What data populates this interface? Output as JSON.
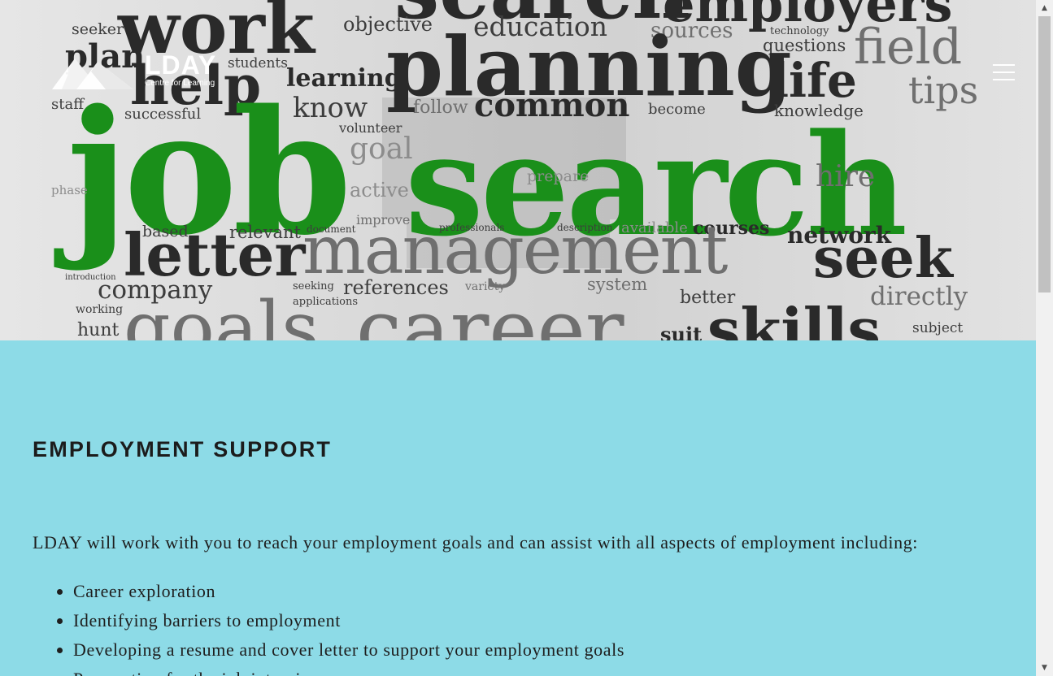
{
  "hero": {
    "words": [
      {
        "text": "employers",
        "cls": "blk"
      },
      {
        "text": "work",
        "cls": "blk"
      },
      {
        "text": "search",
        "cls": "blk"
      },
      {
        "text": "seeker",
        "cls": "drk"
      },
      {
        "text": "plan",
        "cls": "blk"
      },
      {
        "text": "objective",
        "cls": "drk"
      },
      {
        "text": "education",
        "cls": "drk"
      },
      {
        "text": "sources",
        "cls": "gry"
      },
      {
        "text": "technology",
        "cls": "drk"
      },
      {
        "text": "field",
        "cls": "gry"
      },
      {
        "text": "questions",
        "cls": "drk"
      },
      {
        "text": "planning",
        "cls": "blk"
      },
      {
        "text": "life",
        "cls": "blk"
      },
      {
        "text": "tips",
        "cls": "gry"
      },
      {
        "text": "help",
        "cls": "blk"
      },
      {
        "text": "students",
        "cls": "drk"
      },
      {
        "text": "learning",
        "cls": "blk"
      },
      {
        "text": "staff",
        "cls": "drk"
      },
      {
        "text": "successful",
        "cls": "drk"
      },
      {
        "text": "know",
        "cls": "drk"
      },
      {
        "text": "follow",
        "cls": "gry"
      },
      {
        "text": "common",
        "cls": "blk"
      },
      {
        "text": "become",
        "cls": "drk"
      },
      {
        "text": "knowledge",
        "cls": "drk"
      },
      {
        "text": "volunteer",
        "cls": "drk"
      },
      {
        "text": "job",
        "cls": "grn"
      },
      {
        "text": "search",
        "cls": "grn"
      },
      {
        "text": "goal",
        "cls": "lgt"
      },
      {
        "text": "prepare",
        "cls": "lgt"
      },
      {
        "text": "hire",
        "cls": "gry"
      },
      {
        "text": "phase",
        "cls": "lgt"
      },
      {
        "text": "active",
        "cls": "lgt"
      },
      {
        "text": "improve",
        "cls": "gry"
      },
      {
        "text": "based",
        "cls": "drk"
      },
      {
        "text": "relevant",
        "cls": "drk"
      },
      {
        "text": "document",
        "cls": "drk"
      },
      {
        "text": "professionals",
        "cls": "drk"
      },
      {
        "text": "description",
        "cls": "drk"
      },
      {
        "text": "available",
        "cls": "lgt"
      },
      {
        "text": "courses",
        "cls": "blk"
      },
      {
        "text": "network",
        "cls": "blk"
      },
      {
        "text": "letter",
        "cls": "blk"
      },
      {
        "text": "management",
        "cls": "gry"
      },
      {
        "text": "seek",
        "cls": "blk"
      },
      {
        "text": "introduction",
        "cls": "drk"
      },
      {
        "text": "company",
        "cls": "drk"
      },
      {
        "text": "seeking",
        "cls": "drk"
      },
      {
        "text": "applications",
        "cls": "drk"
      },
      {
        "text": "references",
        "cls": "drk"
      },
      {
        "text": "variety",
        "cls": "gry"
      },
      {
        "text": "system",
        "cls": "gry"
      },
      {
        "text": "better",
        "cls": "drk"
      },
      {
        "text": "directly",
        "cls": "gry"
      },
      {
        "text": "working",
        "cls": "drk"
      },
      {
        "text": "hunt",
        "cls": "drk"
      },
      {
        "text": "goals",
        "cls": "gry"
      },
      {
        "text": "career",
        "cls": "gry"
      },
      {
        "text": "suit",
        "cls": "blk"
      },
      {
        "text": "skills",
        "cls": "blk"
      },
      {
        "text": "subject",
        "cls": "drk"
      }
    ]
  },
  "logo": {
    "brand": "LDAY",
    "tagline": "Centre for Learning"
  },
  "section": {
    "heading": "EMPLOYMENT SUPPORT",
    "intro": "LDAY will work with you to reach your employment goals and can assist with all aspects of employment including:",
    "items": [
      "Career exploration",
      "Identifying barriers to employment",
      "Developing a resume and cover letter to support your employment goals",
      "Preparation for the job interview"
    ]
  }
}
